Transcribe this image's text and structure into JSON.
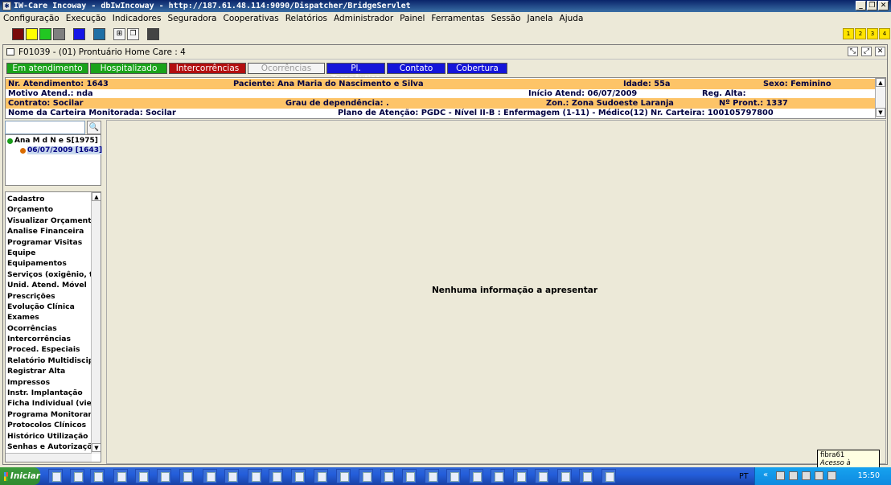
{
  "window": {
    "title": "IW-Care Incoway - dbIwIncoway - http://187.61.48.114:9090/Dispatcher/BridgeServlet"
  },
  "menu": [
    "Configuração",
    "Execução",
    "Indicadores",
    "Seguradora",
    "Cooperativas",
    "Relatórios",
    "Administrador",
    "Painel",
    "Ferramentas",
    "Sessão",
    "Janela",
    "Ajuda"
  ],
  "toolbar": {
    "color_buttons": [
      "#7a0b0b",
      "#ffff00",
      "#22c722",
      "#7f7f7f",
      "#1515e6",
      "#1f6fa5"
    ],
    "numbered": [
      "1",
      "2",
      "3",
      "4"
    ]
  },
  "frame": {
    "title": "F01039 - (01) Prontuário Home Care : 4"
  },
  "tabs": [
    {
      "label": "Em atendimento",
      "color": "#1aa31a"
    },
    {
      "label": "Hospitalizado",
      "color": "#1aa31a"
    },
    {
      "label": "Intercorrências",
      "color": "#b30f0f"
    },
    {
      "label": "Ocorrências",
      "color": "#f4f4f4"
    },
    {
      "label": "Pl. Terapêutico",
      "color": "#1515d9"
    },
    {
      "label": "Contato",
      "color": "#1515d9"
    },
    {
      "label": "Cobertura",
      "color": "#1515d9"
    }
  ],
  "patient": {
    "nr_atendimento": "Nr. Atendimento: 1643",
    "paciente": "Paciente: Ana Maria do Nascimento e Silva",
    "idade": "Idade: 55a",
    "sexo": "Sexo: Feminino",
    "motivo": "Motivo Atend.: nda",
    "inicio": "Início Atend: 06/07/2009",
    "reg_alta": "Reg. Alta:",
    "contrato": "Contrato: Socilar",
    "grau": "Grau de dependência: .",
    "zona": "Zon.: Zona Sudoeste Laranja",
    "pront": "Nº Pront.: 1337",
    "carteira_nome": "Nome da Carteira Monitorada: Socilar",
    "plano": "Plano de Atenção: PGDC - Nível II-B : Enfermagem (1-11) - Médico(12)",
    "nr_carteira": "Nr. Carteira: 100105797800"
  },
  "tree": {
    "root": "Ana M d N e S[1975]",
    "child": "06/07/2009 [1643]"
  },
  "nav": [
    "Cadastro",
    "Orçamento",
    "Visualizar Orçamento",
    "Analise Financeira",
    "Programar Visitas",
    "Equipe",
    "Equipamentos",
    "Serviços (oxigênio, taxa",
    "Unid. Atend. Móvel",
    "Prescrições",
    "Evolução Clínica",
    "Exames",
    "Ocorrências",
    "Intercorrências",
    "Proced. Especiais",
    "Relatório Multidisciplina",
    "Registrar Alta",
    "Impressos",
    "Instr. Implantação",
    "Ficha Individual (viewer",
    "Programa Monitoramer",
    "Protocolos Clínicos",
    "Histórico Utilização",
    "Senhas e Autorizações"
  ],
  "content": {
    "empty_message": "Nenhuma informação a apresentar"
  },
  "tooltip": {
    "line1": "fibra61",
    "line2": "Acesso à Internet"
  },
  "taskbar": {
    "start": "Iniciar",
    "lang": "PT",
    "time": "15:50"
  }
}
